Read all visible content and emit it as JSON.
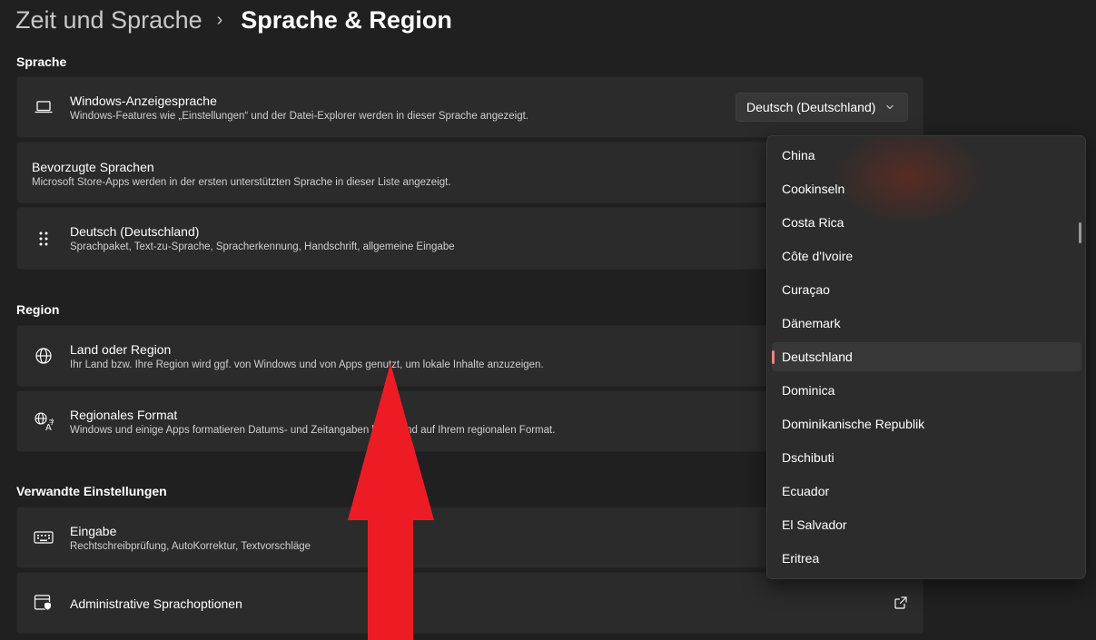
{
  "breadcrumb": {
    "parent": "Zeit und Sprache",
    "separator": "›",
    "current": "Sprache & Region"
  },
  "sections": {
    "language": "Sprache",
    "region": "Region",
    "related": "Verwandte Einstellungen"
  },
  "display_language": {
    "title": "Windows-Anzeigesprache",
    "subtitle": "Windows-Features wie „Einstellungen“ und der Datei-Explorer werden in dieser Sprache angezeigt.",
    "selected": "Deutsch (Deutschland)",
    "icon": "laptop-icon"
  },
  "preferred_languages": {
    "title": "Bevorzugte Sprachen",
    "subtitle": "Microsoft Store-Apps werden in der ersten unterstützten Sprache in dieser Liste angezeigt."
  },
  "language_entry": {
    "title": "Deutsch (Deutschland)",
    "subtitle": "Sprachpaket, Text-zu-Sprache, Spracherkennung, Handschrift, allgemeine Eingabe",
    "icon": "drag-handle-icon"
  },
  "country_region": {
    "title": "Land oder Region",
    "subtitle": "Ihr Land bzw. Ihre Region wird ggf. von Windows und von Apps genutzt, um lokale Inhalte anzuzeigen.",
    "icon": "globe-icon"
  },
  "regional_format": {
    "title": "Regionales Format",
    "subtitle": "Windows und einige Apps formatieren Datums- und Zeitangaben basierend auf Ihrem regionalen Format.",
    "icon": "language-format-icon"
  },
  "typing": {
    "title": "Eingabe",
    "subtitle": "Rechtschreibprüfung, AutoKorrektur, Textvorschläge",
    "icon": "keyboard-icon"
  },
  "admin_language": {
    "title": "Administrative Sprachoptionen",
    "icon": "admin-shield-icon",
    "action_icon": "open-external-icon"
  },
  "country_list": {
    "items": [
      "China",
      "Cookinseln",
      "Costa Rica",
      "Côte d'Ivoire",
      "Curaçao",
      "Dänemark",
      "Deutschland",
      "Dominica",
      "Dominikanische Republik",
      "Dschibuti",
      "Ecuador",
      "El Salvador",
      "Eritrea"
    ],
    "selected": "Deutschland"
  },
  "colors": {
    "background": "#202020",
    "card": "#2b2b2b",
    "flyout": "#2c2c2c",
    "accent": "#f0837a",
    "annotation_arrow": "#ed1c24"
  }
}
